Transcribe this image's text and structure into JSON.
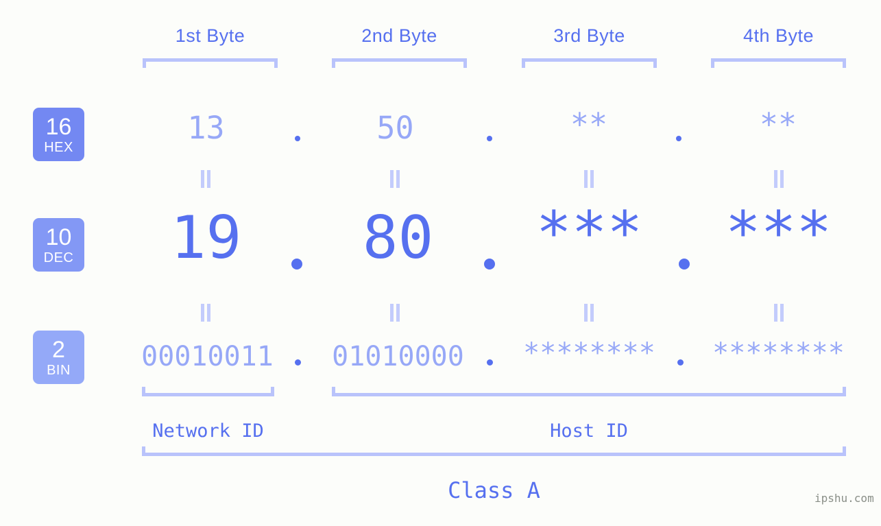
{
  "background_color": "#fcfdfa",
  "accent_color": "#5670ef",
  "accent_light_color": "#97a8f7",
  "bracket_color": "#b9c3fb",
  "byte_headers": [
    {
      "label": "1st Byte"
    },
    {
      "label": "2nd Byte"
    },
    {
      "label": "3rd Byte"
    },
    {
      "label": "4th Byte"
    }
  ],
  "rows": [
    {
      "id": "hex",
      "base_number": "16",
      "base_name": "HEX",
      "badge_color": "#7388f2",
      "values": [
        "13",
        "50",
        "**",
        "**"
      ],
      "separator": "."
    },
    {
      "id": "dec",
      "base_number": "10",
      "base_name": "DEC",
      "badge_color": "#8398f5",
      "values": [
        "19",
        "80",
        "***",
        "***"
      ],
      "separator": "."
    },
    {
      "id": "bin",
      "base_number": "2",
      "base_name": "BIN",
      "badge_color": "#94a9f8",
      "values": [
        "00010011",
        "01010000",
        "********",
        "********"
      ],
      "separator": "."
    }
  ],
  "equality_symbol": "=",
  "footer": {
    "network_id_label": "Network ID",
    "host_id_label": "Host ID",
    "class_label": "Class A"
  },
  "watermark": "ipshu.com"
}
